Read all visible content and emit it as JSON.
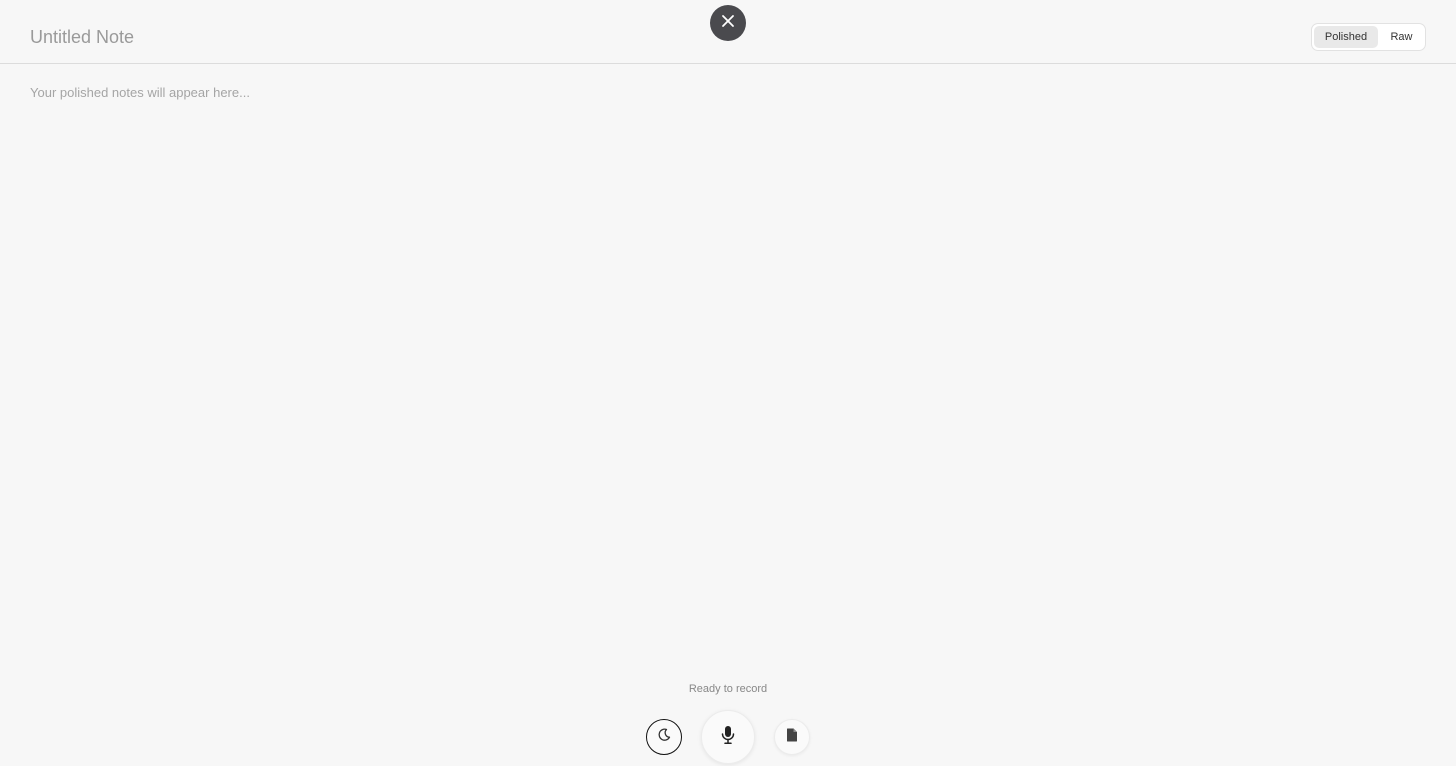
{
  "header": {
    "title": "Untitled Note",
    "close_icon": "close-icon",
    "view_toggle": {
      "options": [
        "Polished",
        "Raw"
      ],
      "selected": "Polished"
    }
  },
  "editor": {
    "placeholder": "Your polished notes will appear here..."
  },
  "footer": {
    "status": "Ready to record",
    "theme_icon": "moon-icon",
    "mic_icon": "microphone-icon",
    "doc_icon": "document-icon"
  },
  "colors": {
    "background": "#f7f7f7",
    "close_button": "#4a4a4e",
    "toggle_active": "#e9e9e9"
  }
}
